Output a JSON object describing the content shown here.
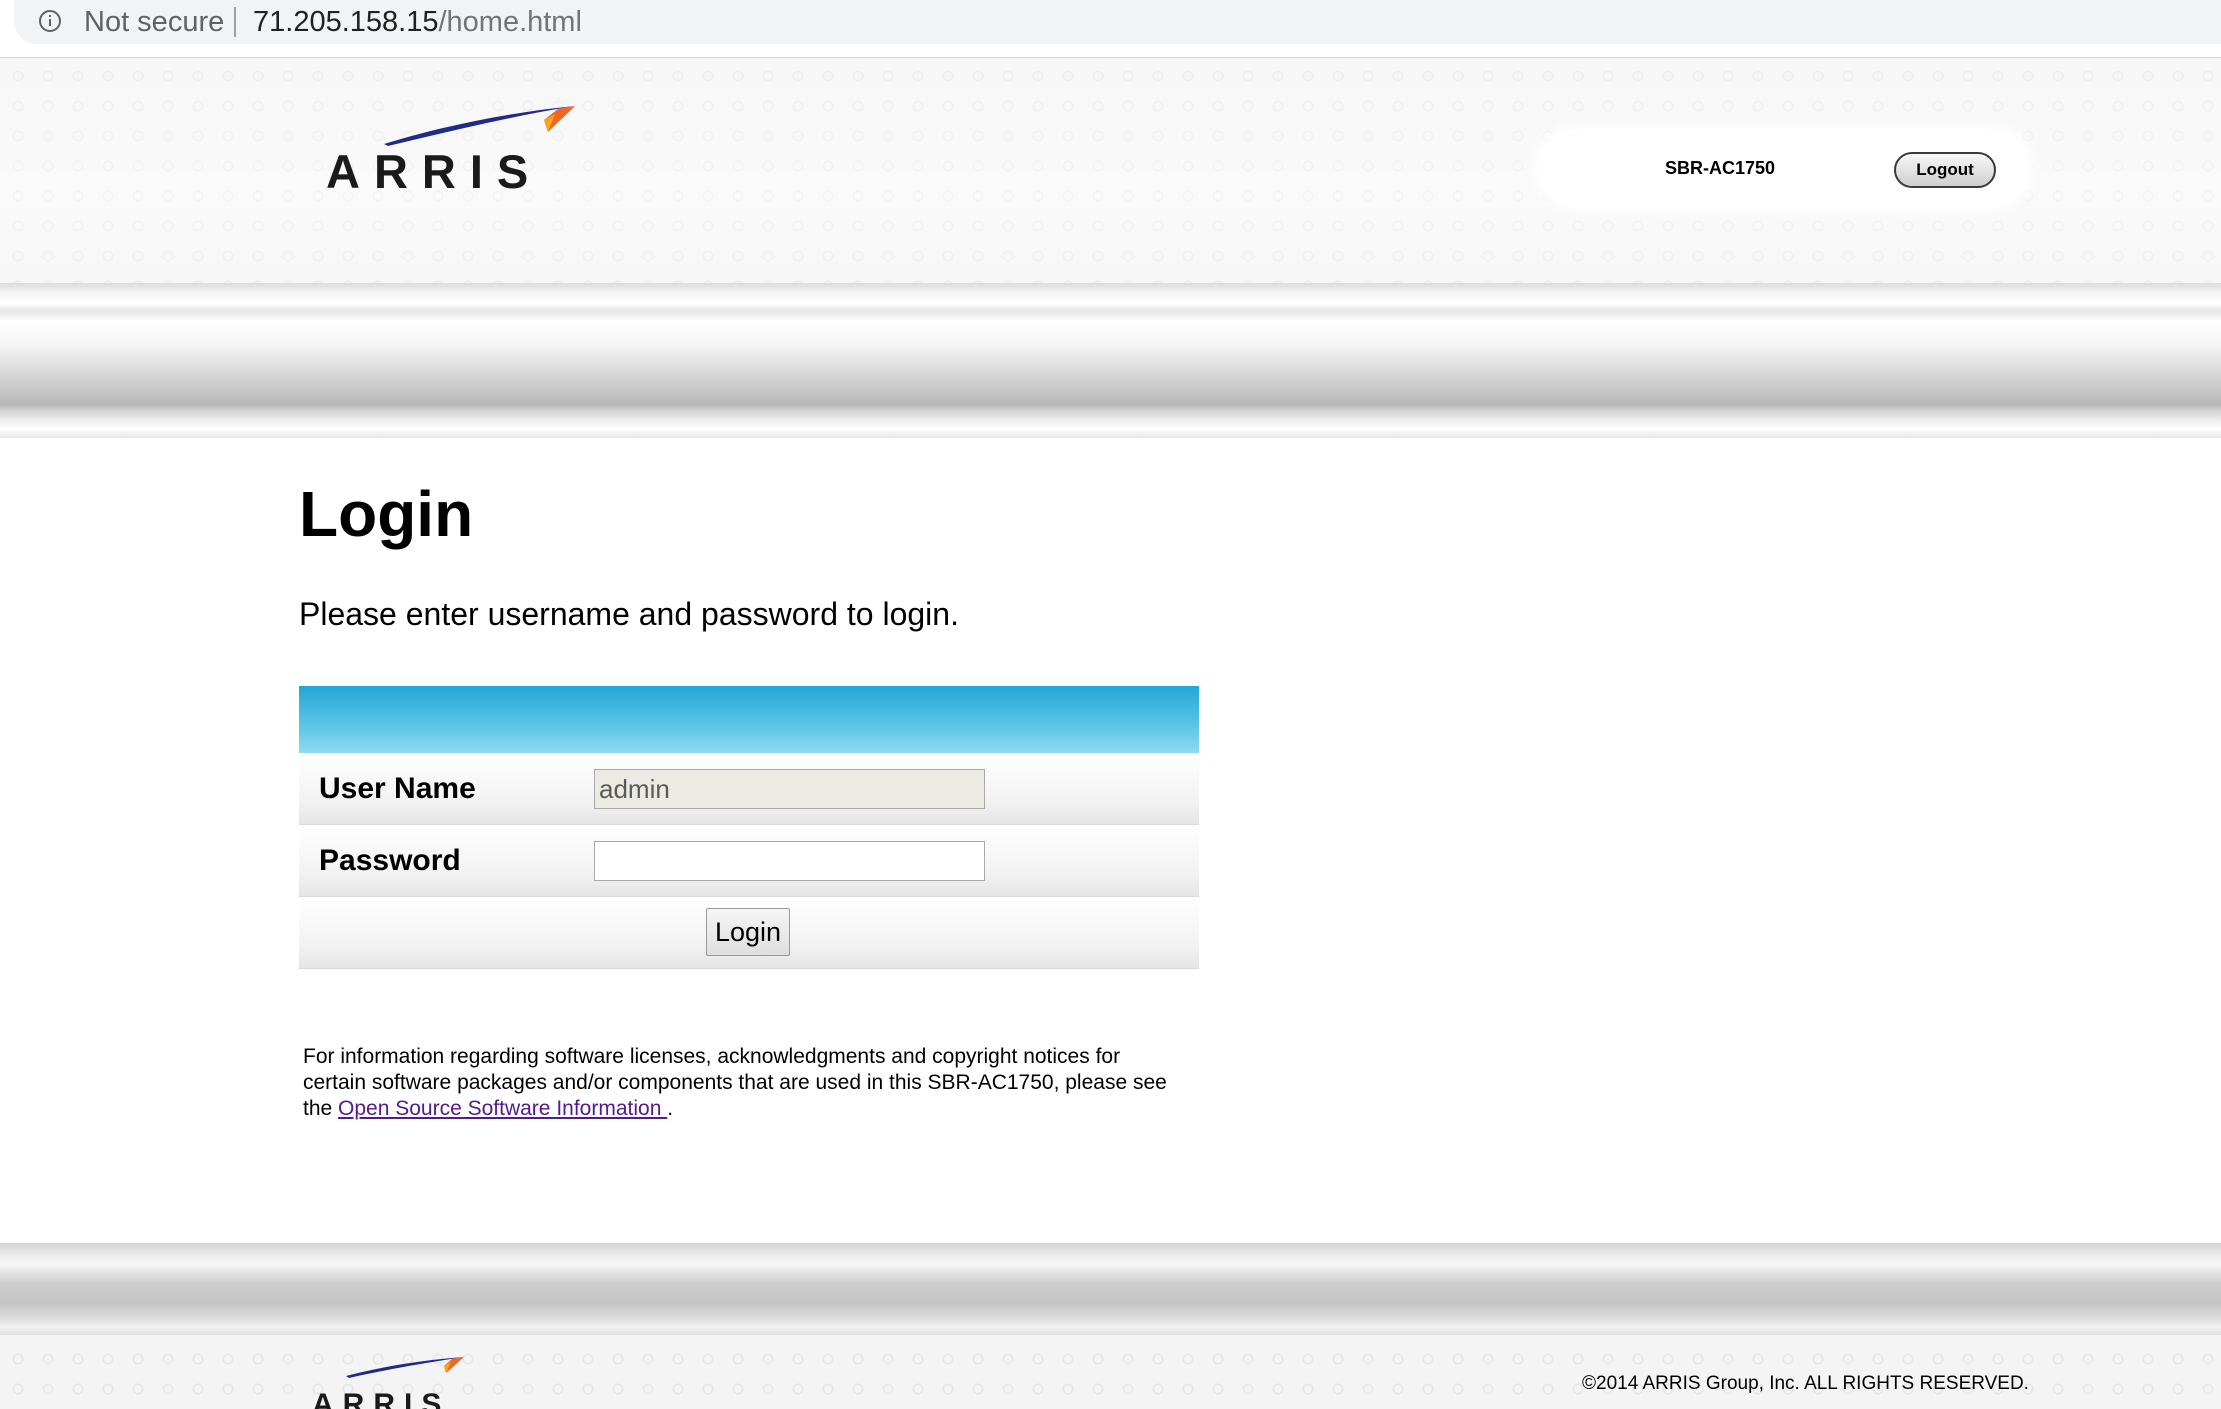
{
  "browser": {
    "security_label": "Not secure",
    "url_host": "71.205.158.15",
    "url_path": "/home.html"
  },
  "header": {
    "brand": "ARRIS",
    "device_name": "SBR-AC1750",
    "logout_label": "Logout"
  },
  "main": {
    "title": "Login",
    "subtitle": "Please enter username and password to login.",
    "form": {
      "username_label": "User Name",
      "username_value": "admin",
      "password_label": "Password",
      "password_value": "",
      "login_button_label": "Login"
    },
    "oss_note": {
      "text_before": "For information regarding software licenses, acknowledgments and copyright notices for certain software packages and/or components that are used in this SBR-AC1750, please see the ",
      "link_text": "Open Source Software Information ",
      "text_after": "."
    }
  },
  "footer": {
    "brand": "ARRIS",
    "copyright": "©2014 ARRIS Group, Inc. ALL RIGHTS RESERVED."
  },
  "colors": {
    "form_header_top": "#22a8d6",
    "form_header_bottom": "#8fd9f2",
    "link_visited": "#551a8b",
    "logo_blue": "#1f2a8a",
    "logo_orange": "#f26522"
  },
  "icons": {
    "security": "info-circle-icon",
    "logo_swoosh": "arris-swoosh-logo"
  }
}
